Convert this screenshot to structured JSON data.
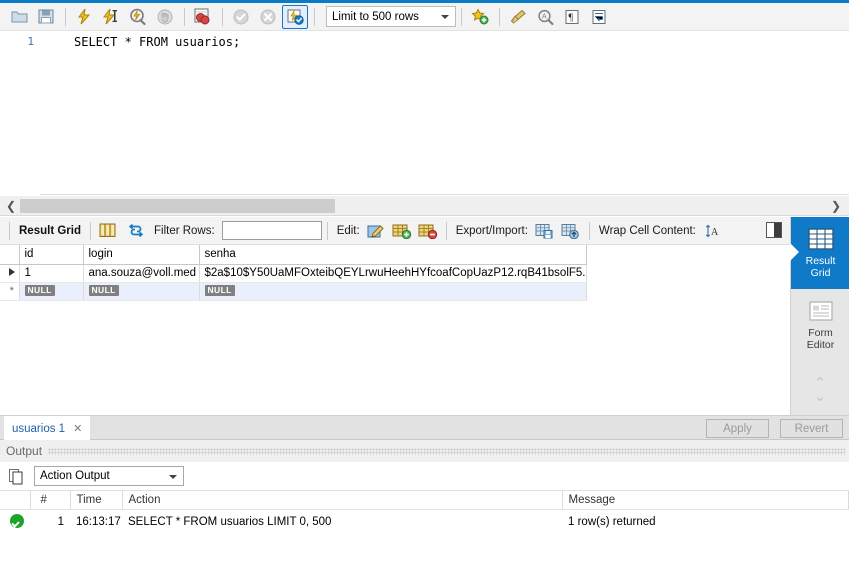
{
  "theme": {
    "accent": "#0a7bc4",
    "panel_active": "#0f7ac8",
    "null_badge": "#808080",
    "success": "#1ea32a",
    "link": "#1f5fa8"
  },
  "toolbar": {
    "icons": [
      {
        "name": "open-sql-file-icon",
        "glyph": "folder"
      },
      {
        "name": "save-sql-file-icon",
        "glyph": "floppy"
      },
      {
        "name": "execute-statement-icon",
        "glyph": "bolt"
      },
      {
        "name": "execute-current-statement-icon",
        "glyph": "bolt-cursor"
      },
      {
        "name": "explain-statement-icon",
        "glyph": "magnifier-bolt"
      },
      {
        "name": "stop-execution-icon",
        "glyph": "hand"
      },
      {
        "name": "toggle-execution-plan-icon",
        "glyph": "red-table"
      },
      {
        "name": "commit-icon",
        "glyph": "check-circle"
      },
      {
        "name": "rollback-icon",
        "glyph": "x-circle"
      },
      {
        "name": "toggle-autocommit-icon",
        "glyph": "bolt-check"
      }
    ],
    "limit_label": "Limit to 500 rows",
    "right_icons": [
      {
        "name": "add-snippet-icon",
        "glyph": "star-plus"
      },
      {
        "name": "beautify-query-icon",
        "glyph": "broom"
      },
      {
        "name": "find-icon",
        "glyph": "magnifier"
      },
      {
        "name": "toggle-invisible-chars-icon",
        "glyph": "pilcrow"
      },
      {
        "name": "wrap-lines-icon",
        "glyph": "wrap"
      }
    ]
  },
  "editor": {
    "line_number": "1",
    "sql": "SELECT * FROM usuarios;"
  },
  "result_toolbar": {
    "result_grid_label": "Result Grid",
    "filter_label": "Filter Rows:",
    "filter_value": "",
    "edit_label": "Edit:",
    "export_import_label": "Export/Import:",
    "wrap_cell_label": "Wrap Cell Content:",
    "icons": [
      {
        "name": "grid-view-icon",
        "glyph": "grid"
      },
      {
        "name": "refresh-icon",
        "glyph": "refresh"
      },
      {
        "name": "edit-row-icon",
        "glyph": "pencil-table"
      },
      {
        "name": "insert-row-icon",
        "glyph": "table-plus"
      },
      {
        "name": "delete-row-icon",
        "glyph": "table-minus"
      },
      {
        "name": "export-recordset-icon",
        "glyph": "table-save"
      },
      {
        "name": "import-recordset-icon",
        "glyph": "table-import"
      },
      {
        "name": "wrap-cell-content-icon",
        "glyph": "IA"
      }
    ]
  },
  "grid": {
    "columns": [
      "",
      "id",
      "login",
      "senha"
    ],
    "rows": [
      {
        "marker": "▶",
        "id": "1",
        "login": "ana.souza@voll.med",
        "senha": "$2a$10$Y50UaMFOxteibQEYLrwuHeehHYfcoafCopUazP12.rqB41bsolF5."
      }
    ],
    "new_row": {
      "marker": "*",
      "id": "NULL",
      "login": "NULL",
      "senha": "NULL"
    }
  },
  "side_panel": {
    "items": [
      {
        "label_line1": "Result",
        "label_line2": "Grid",
        "icon": "result-grid-icon",
        "active": true
      },
      {
        "label_line1": "Form",
        "label_line2": "Editor",
        "icon": "form-editor-icon",
        "active": false
      }
    ]
  },
  "tabbar": {
    "tab_label": "usuarios 1",
    "close_glyph": "✕",
    "apply_label": "Apply",
    "revert_label": "Revert"
  },
  "output": {
    "panel_title": "Output",
    "selector_value": "Action Output",
    "columns": [
      "#",
      "Time",
      "Action",
      "Message"
    ],
    "rows": [
      {
        "status": "success",
        "num": "1",
        "time": "16:13:17",
        "action": "SELECT * FROM usuarios LIMIT 0, 500",
        "message": "1 row(s) returned"
      }
    ]
  }
}
